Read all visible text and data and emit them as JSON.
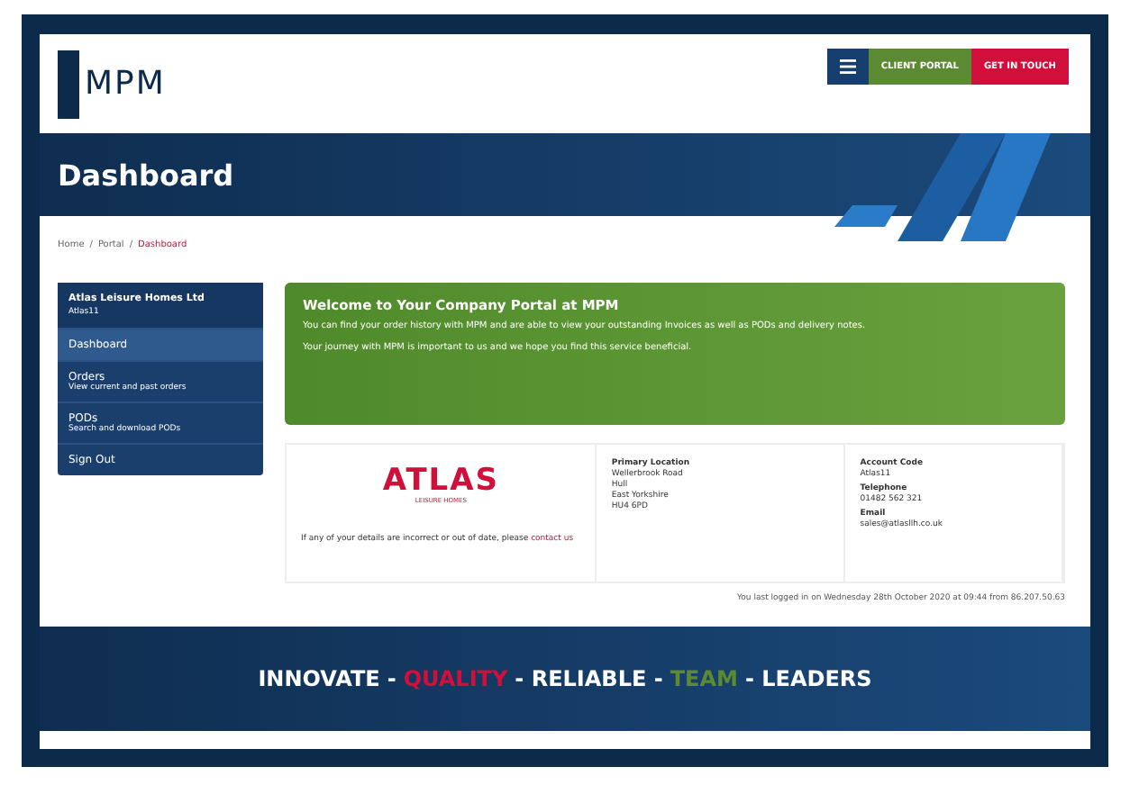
{
  "logo": {
    "text": "MPM"
  },
  "header_buttons": [
    {
      "kind": "menu"
    },
    {
      "kind": "portal",
      "label": "CLIENT PORTAL"
    },
    {
      "kind": "contact",
      "label": "GET IN TOUCH"
    }
  ],
  "banner": {
    "title": "Dashboard"
  },
  "breadcrumb": [
    {
      "label": "Home",
      "selected": false
    },
    {
      "label": "Portal",
      "selected": false
    },
    {
      "label": "Dashboard",
      "selected": true
    }
  ],
  "breadcrumb_separator": "/",
  "sidebar": {
    "company": "Atlas Leisure Homes Ltd",
    "account": "Atlas11",
    "items": [
      {
        "label": "Dashboard",
        "selected": true
      },
      {
        "label": "Orders",
        "sub": "View current and past orders",
        "selected": false
      },
      {
        "label": "PODs",
        "sub": "Search and download PODs",
        "selected": false
      },
      {
        "label": "Sign Out",
        "selected": false
      }
    ]
  },
  "welcome": {
    "title": "Welcome to Your Company Portal at MPM",
    "paragraphs": [
      "You can find your order history with MPM and are able to view your outstanding Invoices as well as PODs and delivery notes.",
      "Your journey with MPM is important to us and we hope you find this service beneficial."
    ]
  },
  "company_card": {
    "brand": "ATLAS",
    "brand_sub": "LEISURE HOMES",
    "note": "If any of your details are incorrect or out of date, please",
    "link": "contact us",
    "location_label": "Primary Location",
    "location_lines": [
      "Wellerbrook Road",
      "Hull",
      "East Yorkshire",
      "HU4 6PD"
    ],
    "fields": [
      {
        "label": "Account Code",
        "value": "Atlas11"
      },
      {
        "label": "Telephone",
        "value": "01482 562 321"
      },
      {
        "label": "Email",
        "value": "sales@atlasllh.co.uk"
      }
    ]
  },
  "last_login": "You last logged in on Wednesday 28th October 2020 at 09:44 from 86.207.50.63",
  "tagline": [
    {
      "text": "INNOVATE",
      "color": "#ffffff"
    },
    {
      "text": "-",
      "color": "#ffffff"
    },
    {
      "text": "QUALITY",
      "color": "#d0103a"
    },
    {
      "text": "- RELIABLE -",
      "color": "#ffffff"
    },
    {
      "text": "TEAM",
      "color": "#5b8a32"
    },
    {
      "text": "- LEADERS",
      "color": "#ffffff"
    }
  ]
}
